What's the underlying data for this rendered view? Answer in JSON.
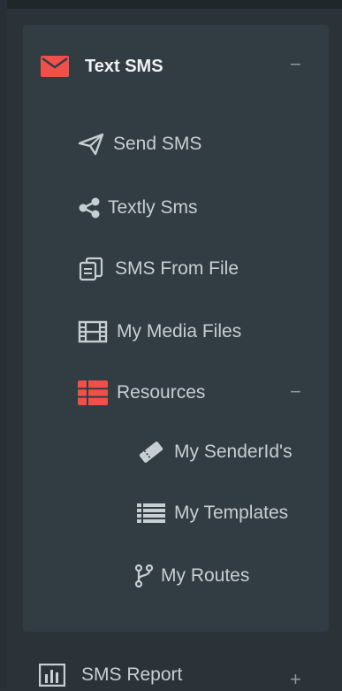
{
  "colors": {
    "accent": "#f0504a",
    "text": "#c7cfd4",
    "panel": "#323c43",
    "background": "#2b3338"
  },
  "menu": {
    "section": {
      "label": "Text SMS",
      "toggle": "−",
      "icon": "envelope-icon"
    },
    "items": [
      {
        "label": "Send SMS",
        "icon": "paper-plane-icon"
      },
      {
        "label": "Textly Sms",
        "icon": "share-icon"
      },
      {
        "label": "SMS From File",
        "icon": "copy-files-icon"
      },
      {
        "label": "My Media Files",
        "icon": "film-icon"
      },
      {
        "label": "Resources",
        "icon": "table-icon",
        "toggle": "−"
      }
    ],
    "resources": [
      {
        "label": "My SenderId's",
        "icon": "ticket-icon"
      },
      {
        "label": "My Templates",
        "icon": "list-icon"
      },
      {
        "label": "My Routes",
        "icon": "fork-icon"
      }
    ]
  },
  "bottom": {
    "label": "SMS Report",
    "toggle": "+",
    "icon": "bar-chart-icon"
  }
}
